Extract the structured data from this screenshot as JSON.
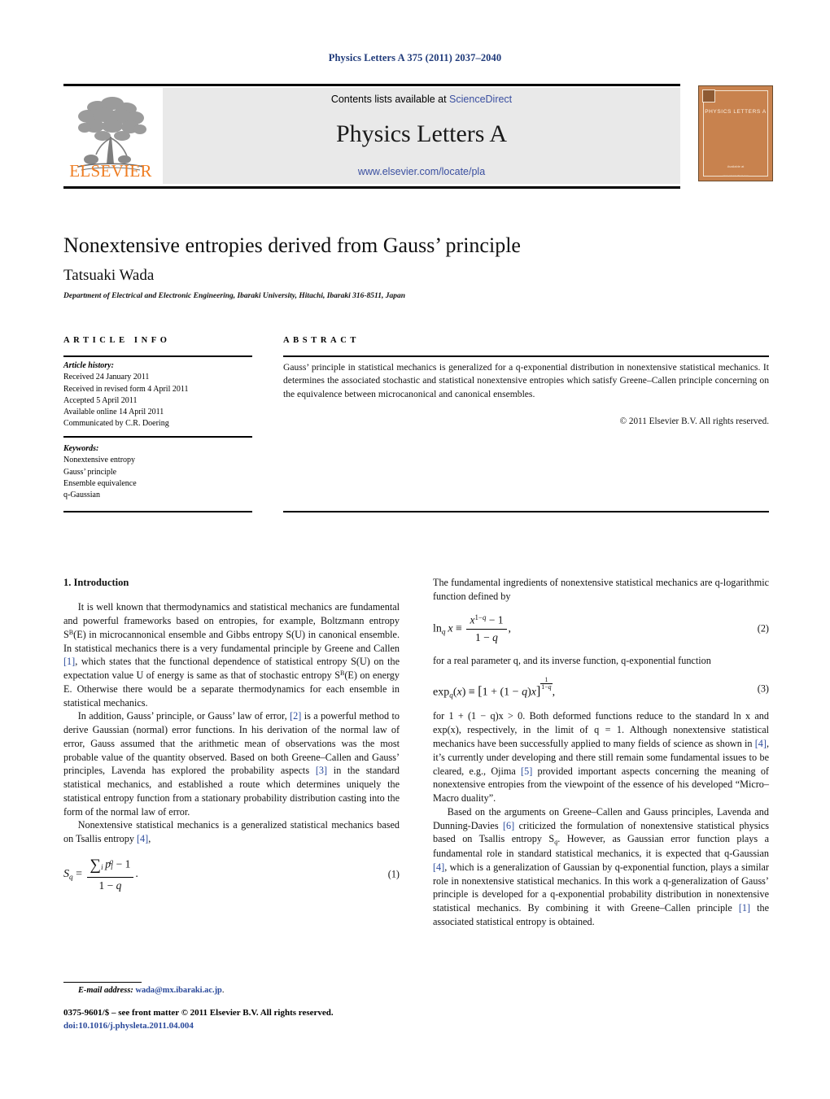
{
  "running_head": "Physics Letters A 375 (2011) 2037–2040",
  "header": {
    "contents_prefix": "Contents lists available at ",
    "sciencedirect": "ScienceDirect",
    "journal_title": "Physics Letters A",
    "journal_url": "www.elsevier.com/locate/pla",
    "publisher_wordmark": "ELSEVIER",
    "cover": {
      "title": "PHYSICS LETTERS A",
      "footer_line1": "Available at",
      "footer_line2": "ScienceDirect",
      "footer_line3": "www.sciencedirect.com"
    }
  },
  "article": {
    "title": "Nonextensive entropies derived from Gauss’ principle",
    "author": "Tatsuaki Wada",
    "affiliation": "Department of Electrical and Electronic Engineering, Ibaraki University, Hitachi, Ibaraki 316-8511, Japan"
  },
  "info": {
    "heading": "ARTICLE INFO",
    "history_label": "Article history:",
    "history": [
      "Received 24 January 2011",
      "Received in revised form 4 April 2011",
      "Accepted 5 April 2011",
      "Available online 14 April 2011",
      "Communicated by C.R. Doering"
    ],
    "keywords_label": "Keywords:",
    "keywords": [
      "Nonextensive entropy",
      "Gauss’ principle",
      "Ensemble equivalence",
      "q-Gaussian"
    ]
  },
  "abstract": {
    "heading": "ABSTRACT",
    "text": "Gauss’ principle in statistical mechanics is generalized for a q-exponential distribution in nonextensive statistical mechanics. It determines the associated stochastic and statistical nonextensive entropies which satisfy Greene–Callen principle concerning on the equivalence between microcanonical and canonical ensembles.",
    "copyright": "© 2011 Elsevier B.V. All rights reserved."
  },
  "body": {
    "section1_heading": "1. Introduction",
    "left_p1_a": "It is well known that thermodynamics and statistical mechanics are fundamental and powerful frameworks based on entropies, for example, Boltzmann entropy S",
    "left_p1_b": "(E) in microcannonical ensemble and Gibbs entropy S(U) in canonical ensemble. In statistical mechanics there is a very fundamental principle by Greene and Callen ",
    "left_p1_ref": "[1]",
    "left_p1_c": ", which states that the functional dependence of statistical entropy S(U) on the expectation value U of energy is same as that of stochastic entropy S",
    "left_p1_d": "(E) on energy E. Otherwise there would be a separate thermodynamics for each ensemble in statistical mechanics.",
    "left_p2_a": "In addition, Gauss’ principle, or Gauss’ law of error, ",
    "left_p2_ref1": "[2]",
    "left_p2_b": " is a powerful method to derive Gaussian (normal) error functions. In his derivation of the normal law of error, Gauss assumed that the arithmetic mean of observations was the most probable value of the quantity observed. Based on both Greene–Callen and Gauss’ principles, Lavenda has explored the probability aspects ",
    "left_p2_ref2": "[3]",
    "left_p2_c": " in the standard statistical mechanics, and established a route which determines uniquely the statistical entropy function from a stationary probability distribution casting into the form of the normal law of error.",
    "left_p3_a": "Nonextensive statistical mechanics is a generalized statistical mechanics based on Tsallis entropy ",
    "left_p3_ref": "[4]",
    "left_p3_b": ",",
    "right_p1": "The fundamental ingredients of nonextensive statistical mechanics are q-logarithmic function defined by",
    "right_p2": "for a real parameter q, and its inverse function, q-exponential function",
    "right_p3_a": "for 1 + (1 − q)x > 0. Both deformed functions reduce to the standard ln x and exp(x), respectively, in the limit of q = 1. Although nonextensive statistical mechanics have been successfully applied to many fields of science as shown in ",
    "right_p3_ref1": "[4]",
    "right_p3_b": ", it’s currently under developing and there still remain some fundamental issues to be cleared, e.g., Ojima ",
    "right_p3_ref2": "[5]",
    "right_p3_c": " provided important aspects concerning the meaning of nonextensive entropies from the viewpoint of the essence of his developed “Micro–Macro duality”.",
    "right_p4_a": "Based on the arguments on Greene–Callen and Gauss principles, Lavenda and Dunning-Davies ",
    "right_p4_ref1": "[6]",
    "right_p4_b": " criticized the formulation of nonextensive statistical physics based on Tsallis entropy S",
    "right_p4_c": ". However, as Gaussian error function plays a fundamental role in standard statistical mechanics, it is expected that q-Gaussian ",
    "right_p4_ref2": "[4]",
    "right_p4_d": ", which is a generalization of Gaussian by q-exponential function, plays a similar role in nonextensive statistical mechanics. In this work a q-generalization of Gauss’ principle is developed for a q-exponential probability distribution in nonextensive statistical mechanics. By combining it with Greene–Callen principle ",
    "right_p4_ref3": "[1]",
    "right_p4_e": " the associated statistical entropy is obtained."
  },
  "equations": {
    "eq1_number": "(1)",
    "eq2_number": "(2)",
    "eq3_number": "(3)"
  },
  "footer": {
    "email_label": "E-mail address:",
    "email": "wada@mx.ibaraki.ac.jp",
    "email_suffix": ".",
    "imprint": "0375-9601/$ – see front matter © 2011 Elsevier B.V. All rights reserved.",
    "doi": "doi:10.1016/j.physleta.2011.04.004"
  },
  "colors": {
    "link": "#2b4a9b",
    "runhead": "#1f3a7a",
    "elsevier_orange": "#ef7d22",
    "banner_bg": "#e9e9e9",
    "cover_bg": "#c8824e"
  }
}
